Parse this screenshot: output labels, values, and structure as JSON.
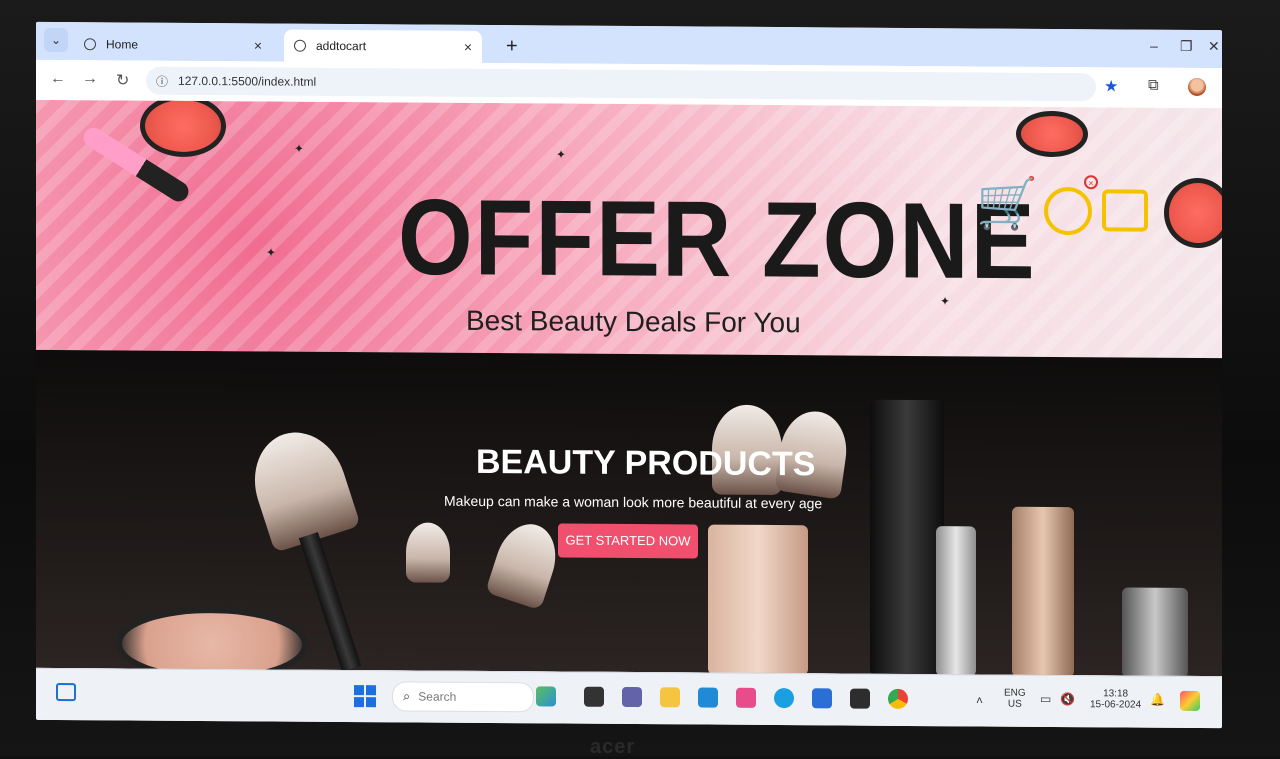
{
  "browser": {
    "tabs": [
      {
        "title": "Home",
        "active": false
      },
      {
        "title": "addtocart",
        "active": true
      }
    ],
    "url": "127.0.0.1:5500/index.html",
    "new_tab_symbol": "+",
    "tab_close_symbol": "×"
  },
  "page": {
    "banner": {
      "title": "OFFER ZONE",
      "subtitle": "Best Beauty Deals For You",
      "accent_color": "#f7a9bd",
      "cart_icon_color": "#1f3fa8"
    },
    "hero": {
      "title": "BEAUTY PRODUCTS",
      "text": "Makeup can make a woman look more beautiful at every age",
      "button_label": "GET STARTED NOW",
      "button_color": "#f0506e"
    }
  },
  "taskbar": {
    "search_placeholder": "Search",
    "language_line1": "ENG",
    "language_line2": "US",
    "time": "13:18",
    "date": "15-06-2024"
  },
  "monitor": {
    "brand": "acer"
  }
}
